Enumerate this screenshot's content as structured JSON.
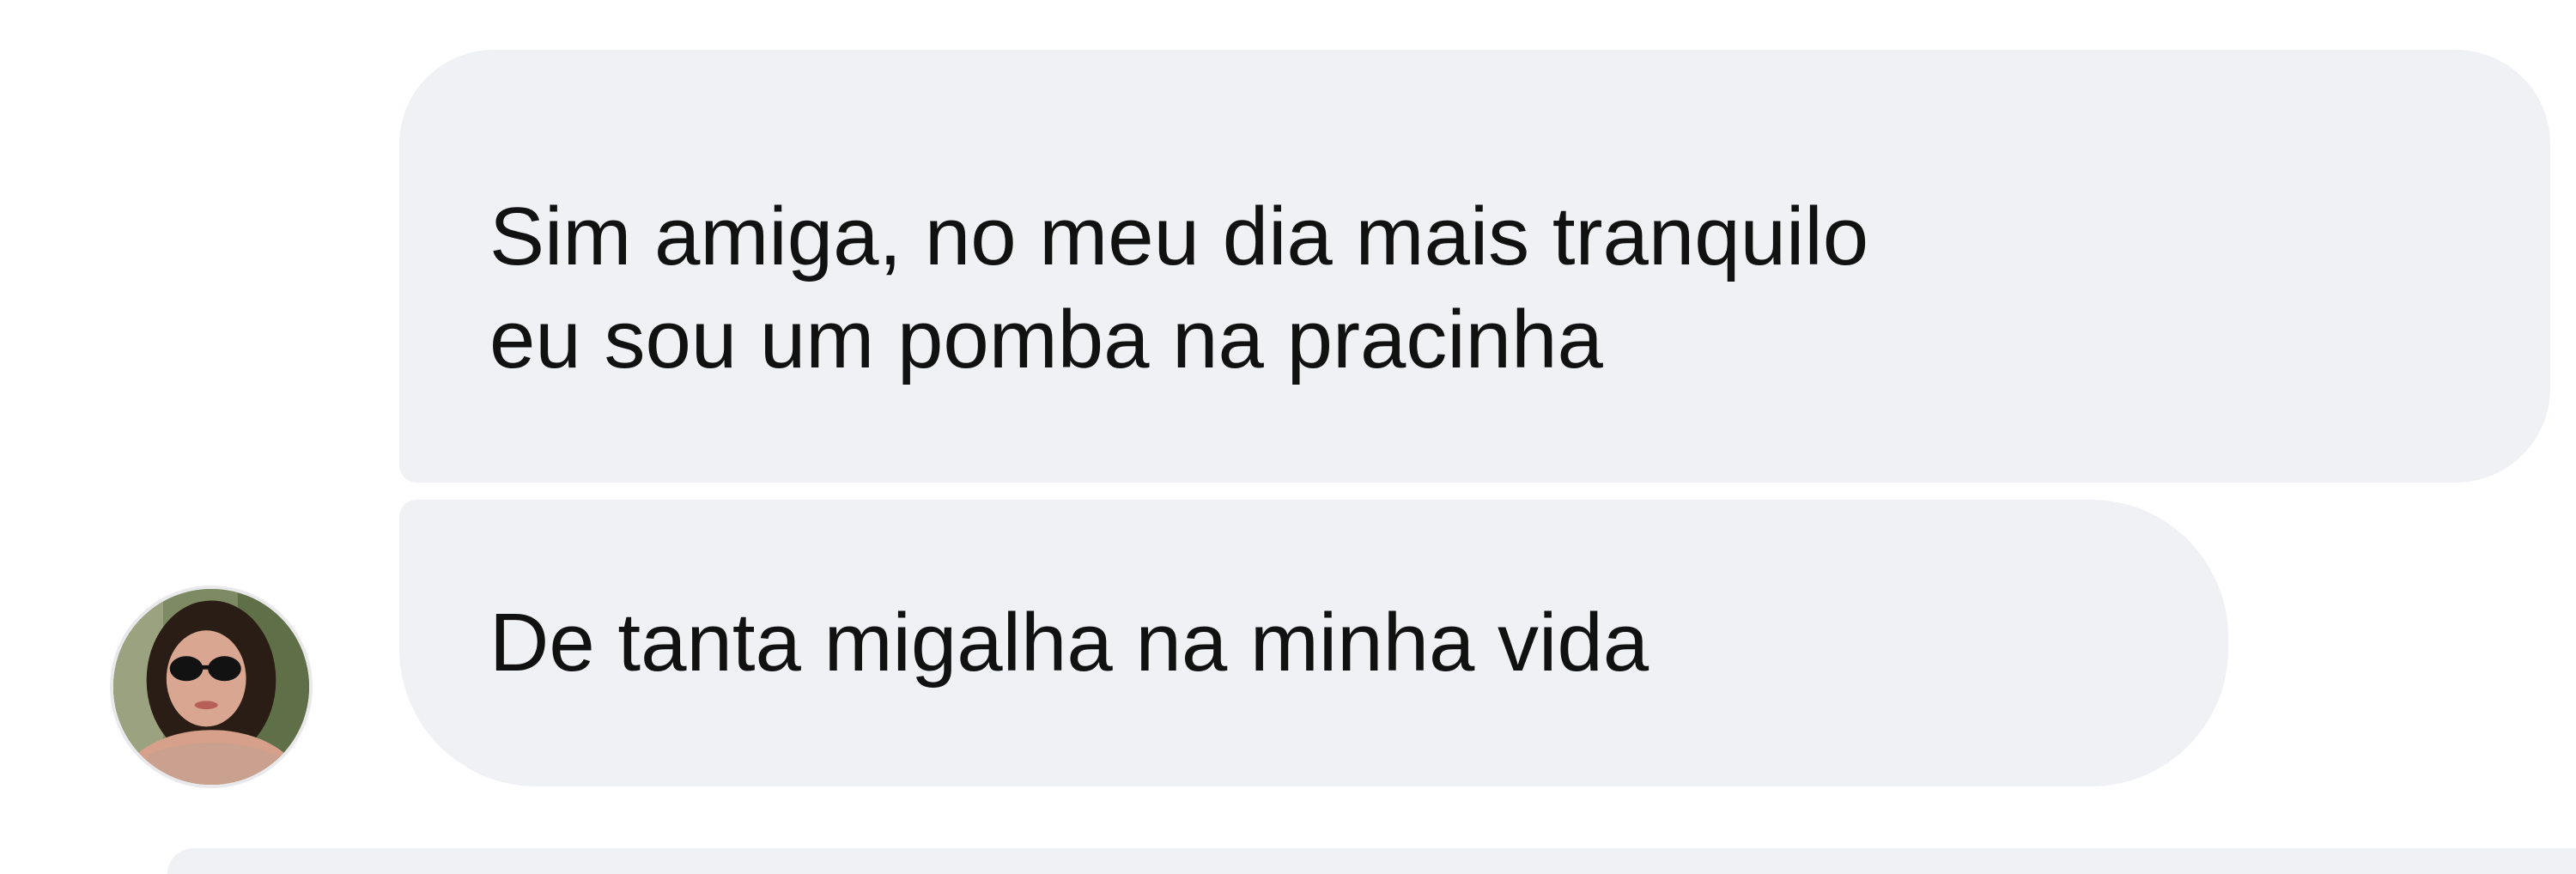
{
  "thread": {
    "messages": [
      {
        "lines": [
          "Sim amiga, no meu dia mais tranquilo",
          "eu sou um pomba na pracinha"
        ]
      },
      {
        "lines": [
          "De tanta migalha na minha vida"
        ]
      }
    ]
  },
  "colors": {
    "bubble_background": "#f0f1f5",
    "text": "#111111",
    "page_background": "#ffffff"
  },
  "icons": {
    "avatar": "contact-avatar-photo"
  }
}
